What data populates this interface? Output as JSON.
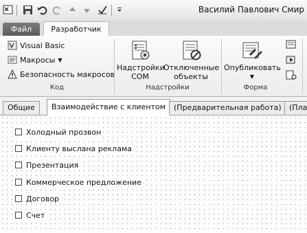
{
  "window": {
    "title": "Василий Павлович Смир"
  },
  "quick_access": {
    "icons": [
      "office-icon",
      "save-icon",
      "undo-icon",
      "redo-icon",
      "up-arrow-icon",
      "down-arrow-icon",
      "check-icon",
      "customize-icon"
    ]
  },
  "tabs": {
    "file": "Файл",
    "developer": "Разработчик"
  },
  "ribbon": {
    "code_group": {
      "label": "Код",
      "visual_basic": "Visual Basic",
      "macros": "Макросы",
      "macro_security": "Безопасность макросов"
    },
    "addins_group": {
      "label": "Надстройки",
      "com_addins_line1": "Надстройки",
      "com_addins_line2": "COM",
      "disabled_line1": "Отключенные",
      "disabled_line2": "объекты"
    },
    "form_group": {
      "label": "Форма",
      "publish": "Опубликовать"
    }
  },
  "form_tabs": [
    {
      "label": "Общие"
    },
    {
      "label": "Взаимодействие с клиентом"
    },
    {
      "label": "(Предварительная работа)"
    },
    {
      "label": "(Пла"
    }
  ],
  "checkboxes": [
    {
      "label": "Холодный прозвон",
      "checked": false
    },
    {
      "label": "Клиенту выслана реклама",
      "checked": false
    },
    {
      "label": "Презентация",
      "checked": false
    },
    {
      "label": "Коммерческое предложение",
      "checked": false
    },
    {
      "label": "Договор",
      "checked": false
    },
    {
      "label": "Счет",
      "checked": false
    }
  ]
}
